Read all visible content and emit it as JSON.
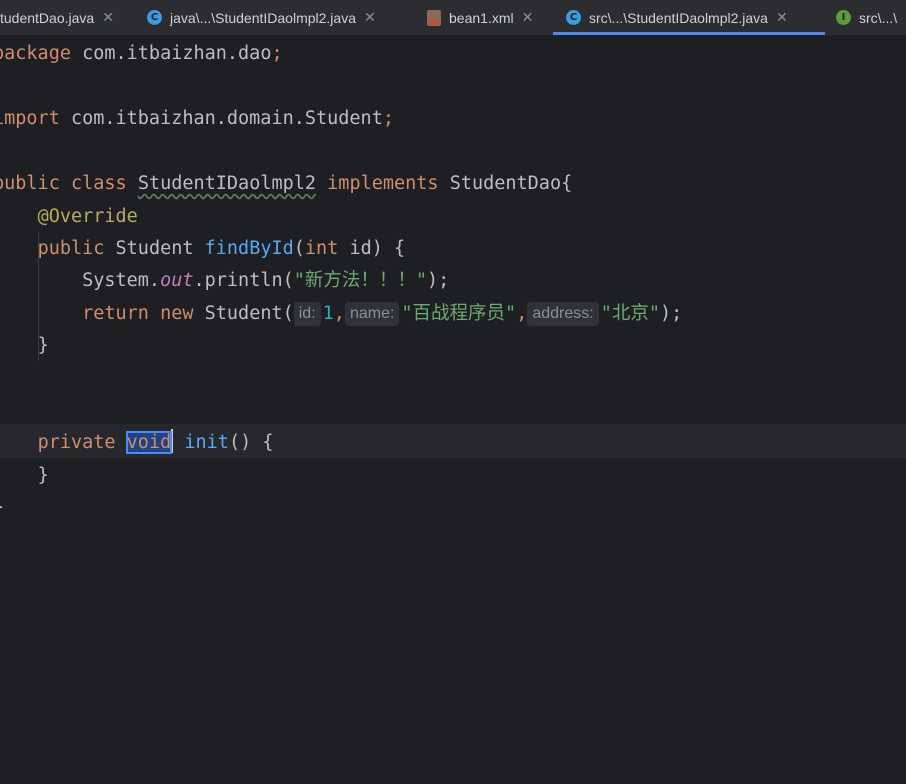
{
  "tabs": [
    {
      "label": "tudentDao.java",
      "icon": "none",
      "active": false
    },
    {
      "label": "java\\...\\StudentIDaolmpl2.java",
      "icon": "class-c-icon",
      "active": false
    },
    {
      "label": "bean1.xml",
      "icon": "xml-file-icon",
      "active": false
    },
    {
      "label": "src\\...\\StudentIDaolmpl2.java",
      "icon": "class-c-icon",
      "active": true
    },
    {
      "label": "src\\...\\",
      "icon": "interface-i-icon",
      "active": false
    }
  ],
  "close_glyph": "✕",
  "code": {
    "l1_kw": "package",
    "l1_rest": " com.itbaizhan.dao",
    "semi": ";",
    "l3_kw": "import",
    "l3_rest": " com.itbaizhan.domain.Student",
    "l5_kw1": "public",
    "l5_kw2": "class",
    "l5_class": "StudentIDaolmpl2",
    "l5_kw3": "implements",
    "l5_iface": "StudentDao{",
    "annotation": "@Override",
    "l7_kw": "public",
    "l7_type": " Student ",
    "l7_fn": "findById",
    "l7_open": "(",
    "l7_int": "int",
    "l7_rest": " id) {",
    "l8_sys": "System.",
    "l8_out": "out",
    "l8_call": ".println(",
    "l8_str": "\"新方法！！！\"",
    "l8_end": ");",
    "l9_return": "return",
    "l9_new": "new",
    "l9_type": " Student(",
    "hint_id": "id:",
    "num_1": "1",
    "comma": ",",
    "hint_name": "name:",
    "str_name": "\"百战程序员\"",
    "hint_address": "address:",
    "str_address": "\"北京\"",
    "l9_end": ");",
    "close_brace": "}",
    "l13_kw": "private",
    "l13_void": "void",
    "l13_fn": "init",
    "l13_rest": "() {",
    "l14": "}",
    "l15": "}"
  }
}
